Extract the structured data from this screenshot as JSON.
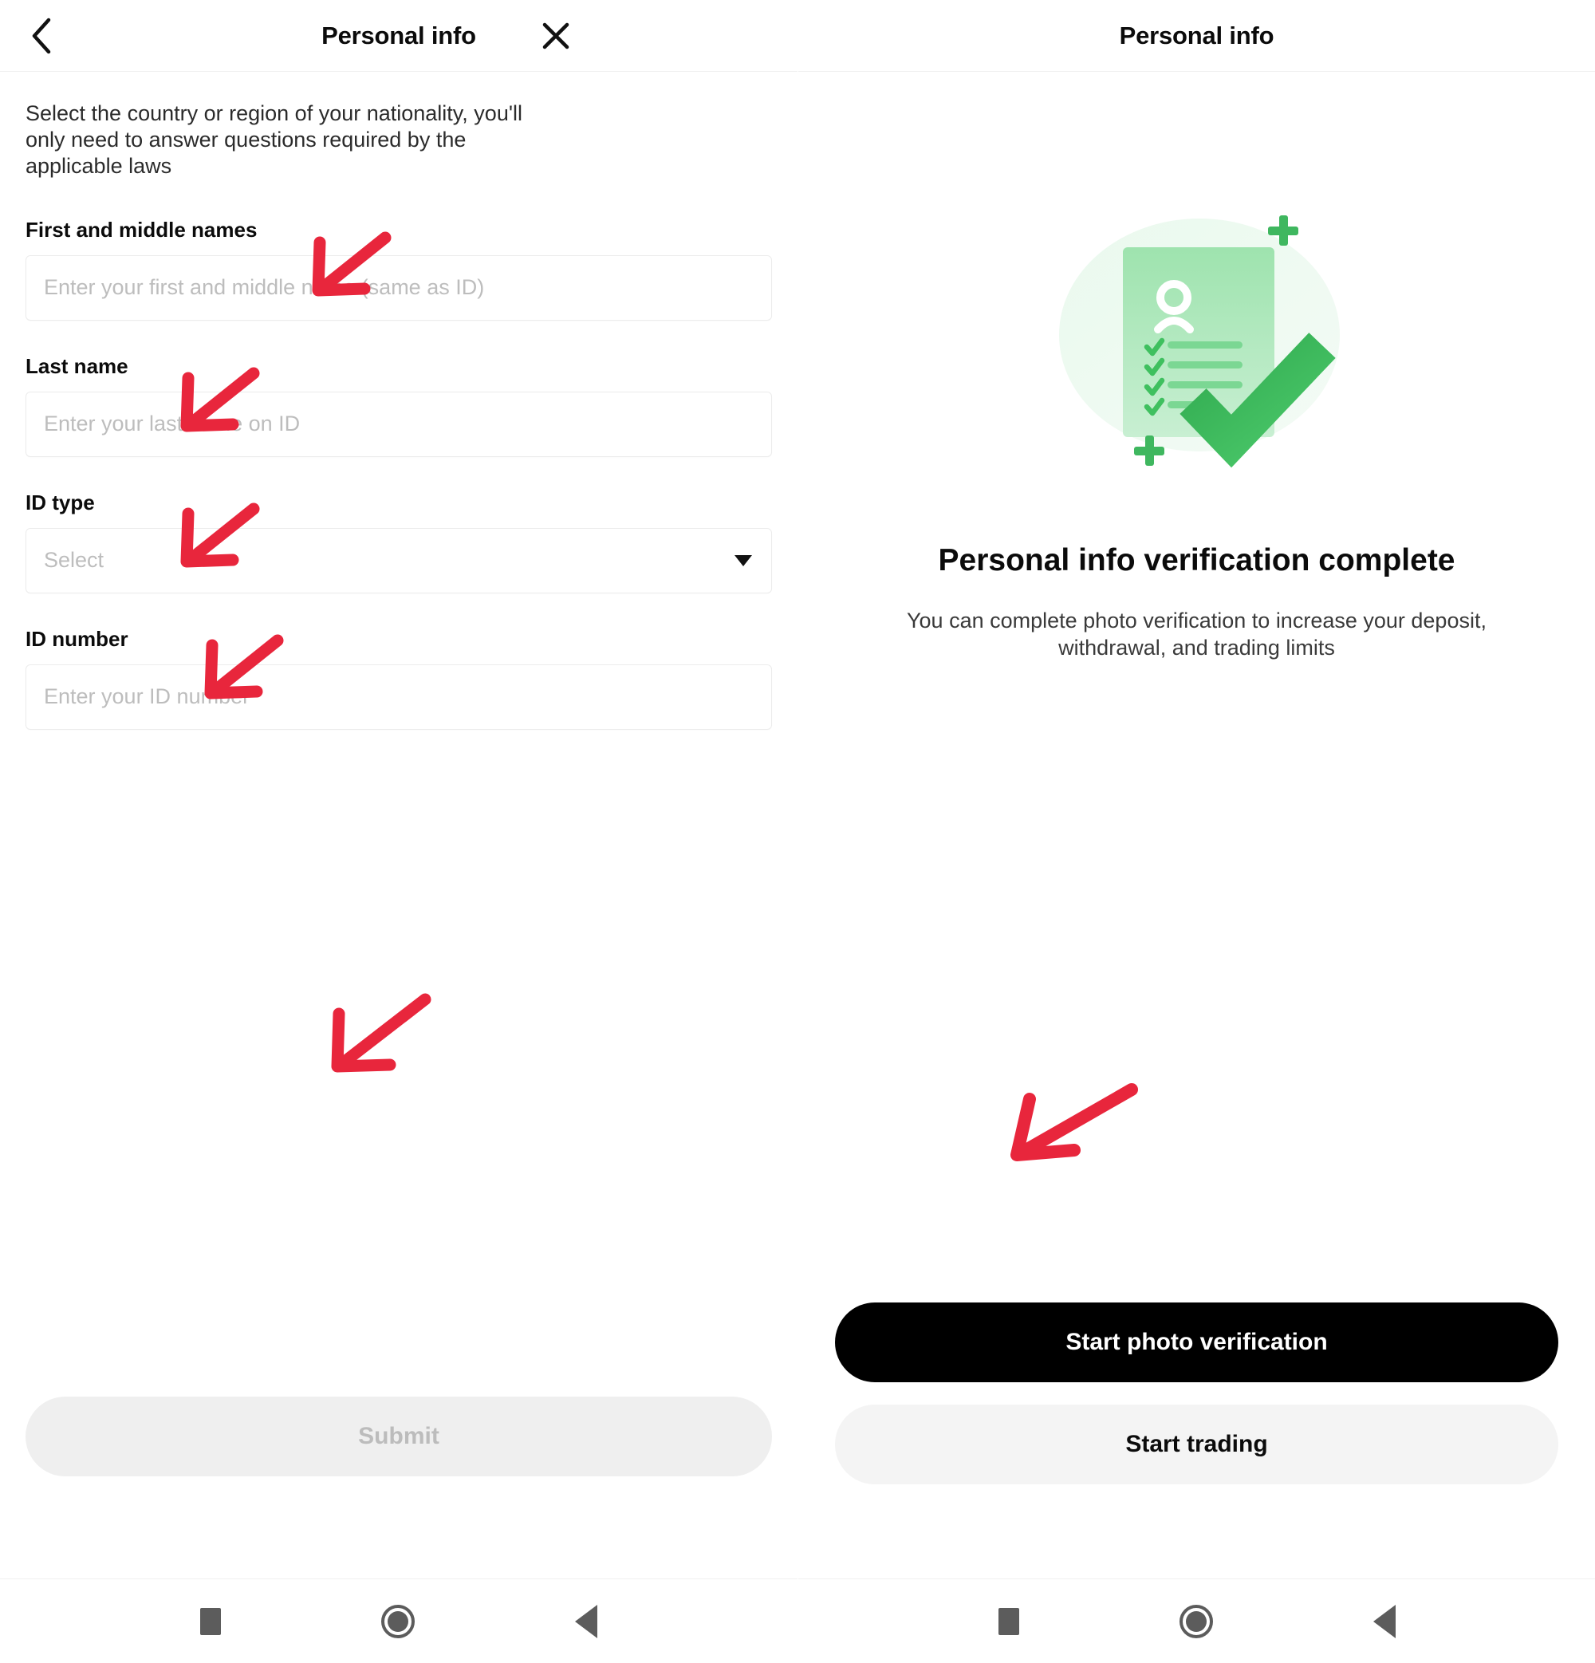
{
  "left_screen": {
    "appbar": {
      "title": "Personal info",
      "back_icon": "chevron-left-icon",
      "close_icon": "close-x-icon"
    },
    "intro_text": "Select the country or region of your nationality, you'll only need to answer questions required by the applicable laws",
    "fields": [
      {
        "label": "First and middle names",
        "placeholder": "Enter your first and middle name (same as ID)",
        "type": "text",
        "value": ""
      },
      {
        "label": "Last name",
        "placeholder": "Enter your last name on ID",
        "type": "text",
        "value": ""
      },
      {
        "label": "ID type",
        "placeholder": "Select",
        "type": "select",
        "value": "",
        "caret_icon": "caret-down-icon"
      },
      {
        "label": "ID number",
        "placeholder": "Enter your ID number",
        "type": "text",
        "value": ""
      }
    ],
    "submit_label": "Submit",
    "submit_enabled": false
  },
  "right_screen": {
    "appbar": {
      "title": "Personal info"
    },
    "illustration": {
      "name": "id-document-verified-illustration",
      "document_icon": "person-document-icon",
      "check_icon": "green-checkmark-icon",
      "plus_icons": [
        "plus-icon",
        "plus-icon"
      ],
      "checklist_rows": 4
    },
    "success_title": "Personal info verification complete",
    "success_subtitle": "You can complete photo verification to increase your deposit, withdrawal, and trading limits",
    "primary_button_label": "Start photo verification",
    "secondary_button_label": "Start trading"
  },
  "navbar": {
    "items": [
      {
        "icon": "recents-square-icon"
      },
      {
        "icon": "home-circle-icon"
      },
      {
        "icon": "back-triangle-icon"
      }
    ]
  },
  "annotations": {
    "color": "#E8263C",
    "arrows": [
      {
        "target": "first-and-middle-names-label",
        "direction": "down-left"
      },
      {
        "target": "last-name-label",
        "direction": "down-left"
      },
      {
        "target": "id-type-label",
        "direction": "down-left"
      },
      {
        "target": "id-number-label",
        "direction": "down-left"
      },
      {
        "target": "submit-button",
        "direction": "down-left"
      },
      {
        "target": "start-trading-button",
        "direction": "down-left"
      }
    ]
  },
  "colors": {
    "accent_green": "#3BBD5E",
    "annotation_red": "#E8263C",
    "primary_black": "#000000",
    "disabled_grey": "#EFEFEF"
  }
}
